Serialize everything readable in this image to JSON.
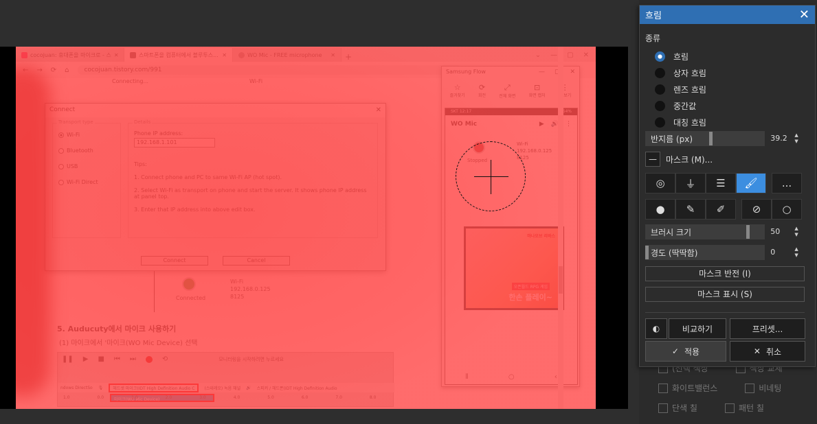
{
  "browser": {
    "tabs": [
      "cocojuan: 휴대폰을 마이크로 - 스",
      "스마트폰을 컴퓨터에서 블루투스...",
      "WO Mic - FREE microphone"
    ],
    "url": "cocojuan.tistory.com/991",
    "status_left": "Connecting...",
    "status_right": "Wi-Fi"
  },
  "connect_dialog": {
    "title": "Connect",
    "transport_caption": "Transport type",
    "options": [
      "Wi-Fi",
      "Bluetooth",
      "USB",
      "Wi-Fi Direct"
    ],
    "details_caption": "Details",
    "ip_label": "Phone IP address:",
    "ip_value": "192.168.1.101",
    "tips_title": "Tips:",
    "tips": [
      "1. Connect phone and PC to same Wi-Fi AP (hot spot).",
      "2. Select Wi-Fi as transport on phone and start the server. It shows phone IP address at panel top.",
      "3. Enter that IP address into above edit box."
    ],
    "connect_btn": "Connect",
    "cancel_btn": "Cancel"
  },
  "page": {
    "connected_label": "Connected",
    "wifi": "Wi-Fi",
    "ip": "192.168.0.125",
    "port": "8125",
    "heading": "5. Auducuty에서 마이크 사용하기",
    "subheading": "(1) 마이크에서 '마이크(WO Mic Device) 선택",
    "device_input": "헤드셋 마이크(IDT High Definition Audio C",
    "device_channel": "(스테레오) 녹음 채널",
    "device_output": "스피커 / 헤드폰(IDT High Definition Audio",
    "device_host": "ndows DirectSo",
    "dropdown_selected": "마이크(WO Mic Device)",
    "monitor_hint": "모니터링을 시작하려면 누르세요",
    "ruler": [
      "1.0",
      "0.0",
      "1.0",
      "2.0",
      "3.0",
      "4.0",
      "5.0",
      "6.0",
      "7.0",
      "8.0"
    ]
  },
  "samsung_flow": {
    "title": "Samsung Flow",
    "tools": [
      "즐겨찾기",
      "회전",
      "전체 화면",
      "화면 캡처",
      "더 보기"
    ],
    "status_left": "SKT 12:17",
    "status_right": "64%",
    "app_name": "WO Mic",
    "stopped": "Stopped",
    "wifi": "Wi-Fi",
    "ip": "192.168.0.125",
    "port": "8125",
    "ad_top": "마나오브 리바스",
    "ad_mid": "오픈월드 RPG 게임",
    "ad_bottom": "한손 플레이~"
  },
  "behind_panel": {
    "items": [
      "(선택 색상",
      "색상 교체",
      "화이트밸런스",
      "비네팅",
      "단색 칠",
      "패턴 칠"
    ]
  },
  "blur_panel": {
    "title": "흐림",
    "type_label": "종류",
    "types": [
      "흐림",
      "상자 흐림",
      "렌즈 흐림",
      "중간값",
      "대칭 흐림"
    ],
    "selected_type": 0,
    "radius_label": "반지름 (px)",
    "radius_value": "39.2",
    "mask_label": "마스크 (M)...",
    "brush_size_label": "브러시 크기",
    "brush_size_value": "50",
    "hardness_label": "경도 (딱딱함)",
    "hardness_value": "0",
    "invert_mask": "마스크 반전 (I)",
    "show_mask": "마스크 표시 (S)",
    "compare": "비교하기",
    "preset": "프리셋...",
    "apply": "적용",
    "cancel": "취소",
    "more": "...",
    "accent": "#3c8ee0",
    "title_bar_color": "#2f6fb3"
  }
}
